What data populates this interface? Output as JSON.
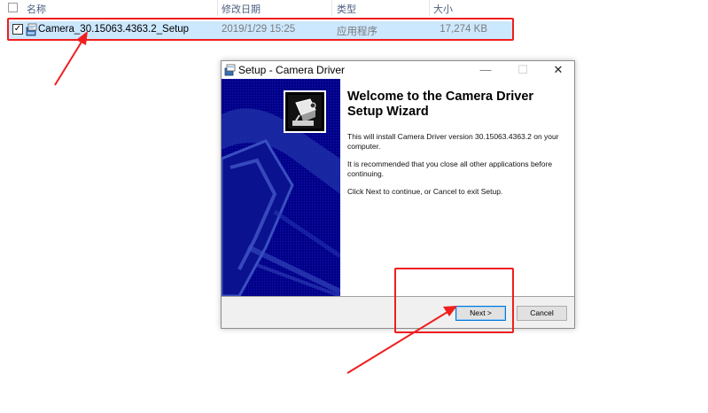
{
  "explorer": {
    "columns": {
      "name": "名称",
      "date": "修改日期",
      "type": "类型",
      "size": "大小"
    },
    "file": {
      "name": "Camera_30.15063.4363.2_Setup",
      "modified": "2019/1/29 15:25",
      "type": "应用程序",
      "size": "17,274 KB"
    }
  },
  "setup_window": {
    "title": "Setup - Camera Driver",
    "heading": "Welcome to the Camera Driver Setup Wizard",
    "paragraph1": "This will install Camera Driver version 30.15063.4363.2 on your computer.",
    "paragraph2": "It is recommended that you close all other applications before continuing.",
    "paragraph3": "Click Next to continue, or Cancel to exit Setup.",
    "next_label": "Next >",
    "cancel_label": "Cancel",
    "minimize_glyph": "—",
    "maximize_glyph": "☐",
    "close_glyph": "✕"
  },
  "annotations": {
    "highlight_color": "#f01e1e"
  },
  "colors": {
    "banner": "#00008a",
    "selection": "#cce8ff"
  }
}
